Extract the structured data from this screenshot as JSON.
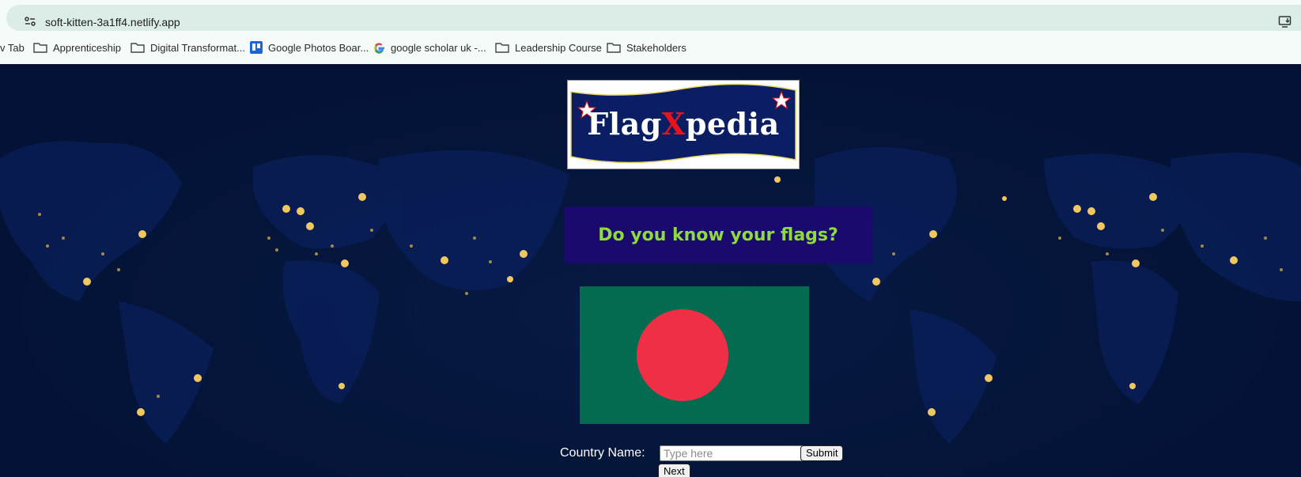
{
  "browser": {
    "url": "soft-kitten-3a1ff4.netlify.app",
    "bookmarks": [
      {
        "label": "v Tab",
        "icon": "none"
      },
      {
        "label": "Apprenticeship",
        "icon": "folder-icon"
      },
      {
        "label": "Digital Transformat...",
        "icon": "folder-icon"
      },
      {
        "label": "Google Photos Boar...",
        "icon": "trello-icon"
      },
      {
        "label": "google scholar uk -...",
        "icon": "google-icon"
      },
      {
        "label": "Leadership Course",
        "icon": "folder-icon"
      },
      {
        "label": "Stakeholders",
        "icon": "folder-icon"
      }
    ]
  },
  "page": {
    "logo": {
      "part1": "Flag",
      "part2": "X",
      "part3": "pedia"
    },
    "question": "Do you know your flags?",
    "flag": {
      "field_color": "#036b4f",
      "disc_color": "#ee2f45"
    },
    "form": {
      "label": "Country Name:",
      "placeholder": "Type here",
      "value": "",
      "submit_label": "Submit",
      "next_label": "Next"
    }
  },
  "colors": {
    "page_bg": "#041335",
    "question_bg": "#1a0a6e",
    "question_text": "#8fdb3f",
    "logo_banner": "#0b1d63",
    "logo_x": "#e8131b"
  }
}
